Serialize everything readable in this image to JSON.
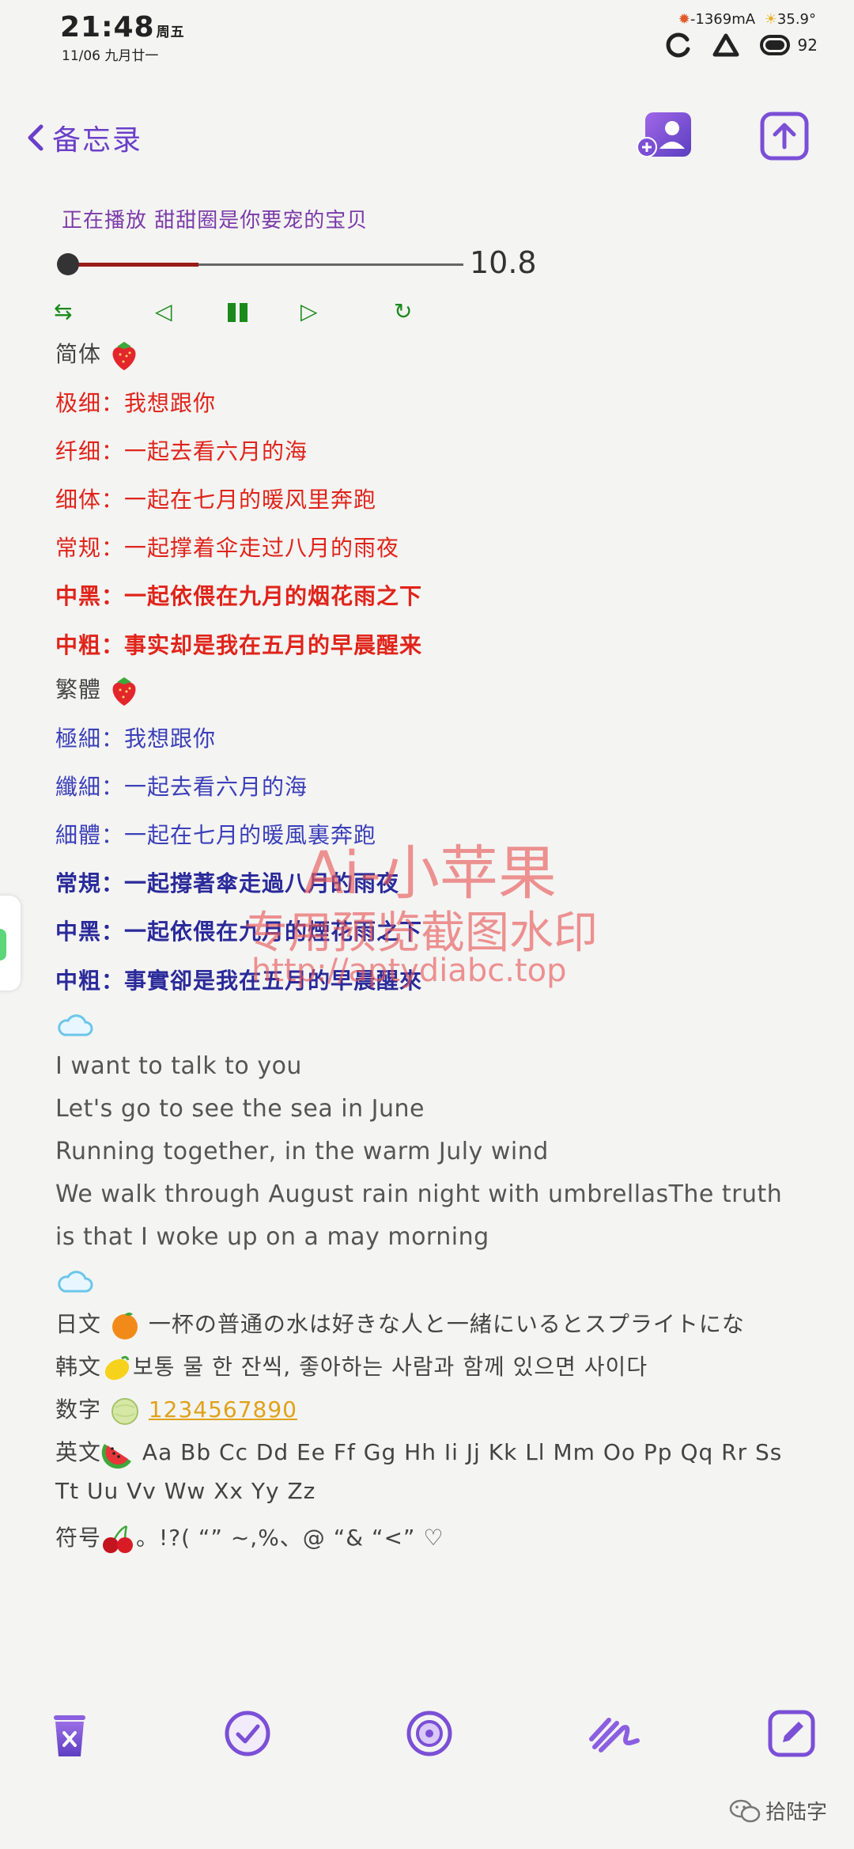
{
  "status_bar": {
    "time": "21:48",
    "weekday": "周五",
    "date": "11/06 九月廿一",
    "current": "-1369mA",
    "temperature": "35.9°",
    "battery": "92"
  },
  "header": {
    "back_label": "备忘录"
  },
  "player": {
    "now_playing": "正在播放 甜甜圈是你要宠的宝贝",
    "progress": 0.33,
    "time": "10.8"
  },
  "simplified": {
    "heading": "简体",
    "lines": [
      "极细：我想跟你",
      "纤细：一起去看六月的海",
      "细体：一起在七月的暖风里奔跑",
      "常规：一起撑着伞走过八月的雨夜",
      "中黑：一起依偎在九月的烟花雨之下",
      "中粗：事实却是我在五月的早晨醒来"
    ]
  },
  "traditional": {
    "heading": "繁體",
    "lines": [
      "極細：我想跟你",
      "纖細：一起去看六月的海",
      "細體：一起在七月的暖風裏奔跑",
      "常規：一起撐著傘走過八月的雨夜",
      "中黑：一起依偎在九月的煙花雨之下",
      "中粗：事實卻是我在五月的早晨醒來"
    ]
  },
  "english": {
    "lines": [
      "I want to talk to you",
      "Let's go to see the sea in June",
      "Running together, in the warm July wind",
      "We walk through August rain night with umbrellasThe truth",
      "is that I woke up on a may morning"
    ]
  },
  "samples": {
    "japanese_label": "日文",
    "japanese_text": "一杯の普通の水は好きな人と一緒にいるとスプライトにな",
    "korean_label": "韩文",
    "korean_text": "보통 물 한 잔씩, 좋아하는 사람과 함께 있으면 사이다",
    "digits_label": "数字",
    "digits_text": "1234567890",
    "english_label": "英文",
    "english_text_1": "Aa Bb Cc Dd Ee Ff Gg Hh Ii Jj Kk Ll Mm Oo Pp Qq Rr Ss",
    "english_text_2": "Tt Uu Vv Ww Xx Yy Zz",
    "symbols_label": "符号",
    "symbols_text": "。!?( “” ~,%、@ “& “<” ♡"
  },
  "watermark": {
    "line1": "Ai-小苹果",
    "line2": "专用预览截图水印",
    "line3": "http://aptydiabc.top"
  },
  "footer": {
    "brand": "拾陆字"
  },
  "colors": {
    "accent": "#7b4fd6",
    "player_green": "#1a8a1a",
    "simplified_red": "#e0241a",
    "traditional_blue": "#3b3fb8",
    "digits_yellow": "#e0a21a"
  }
}
